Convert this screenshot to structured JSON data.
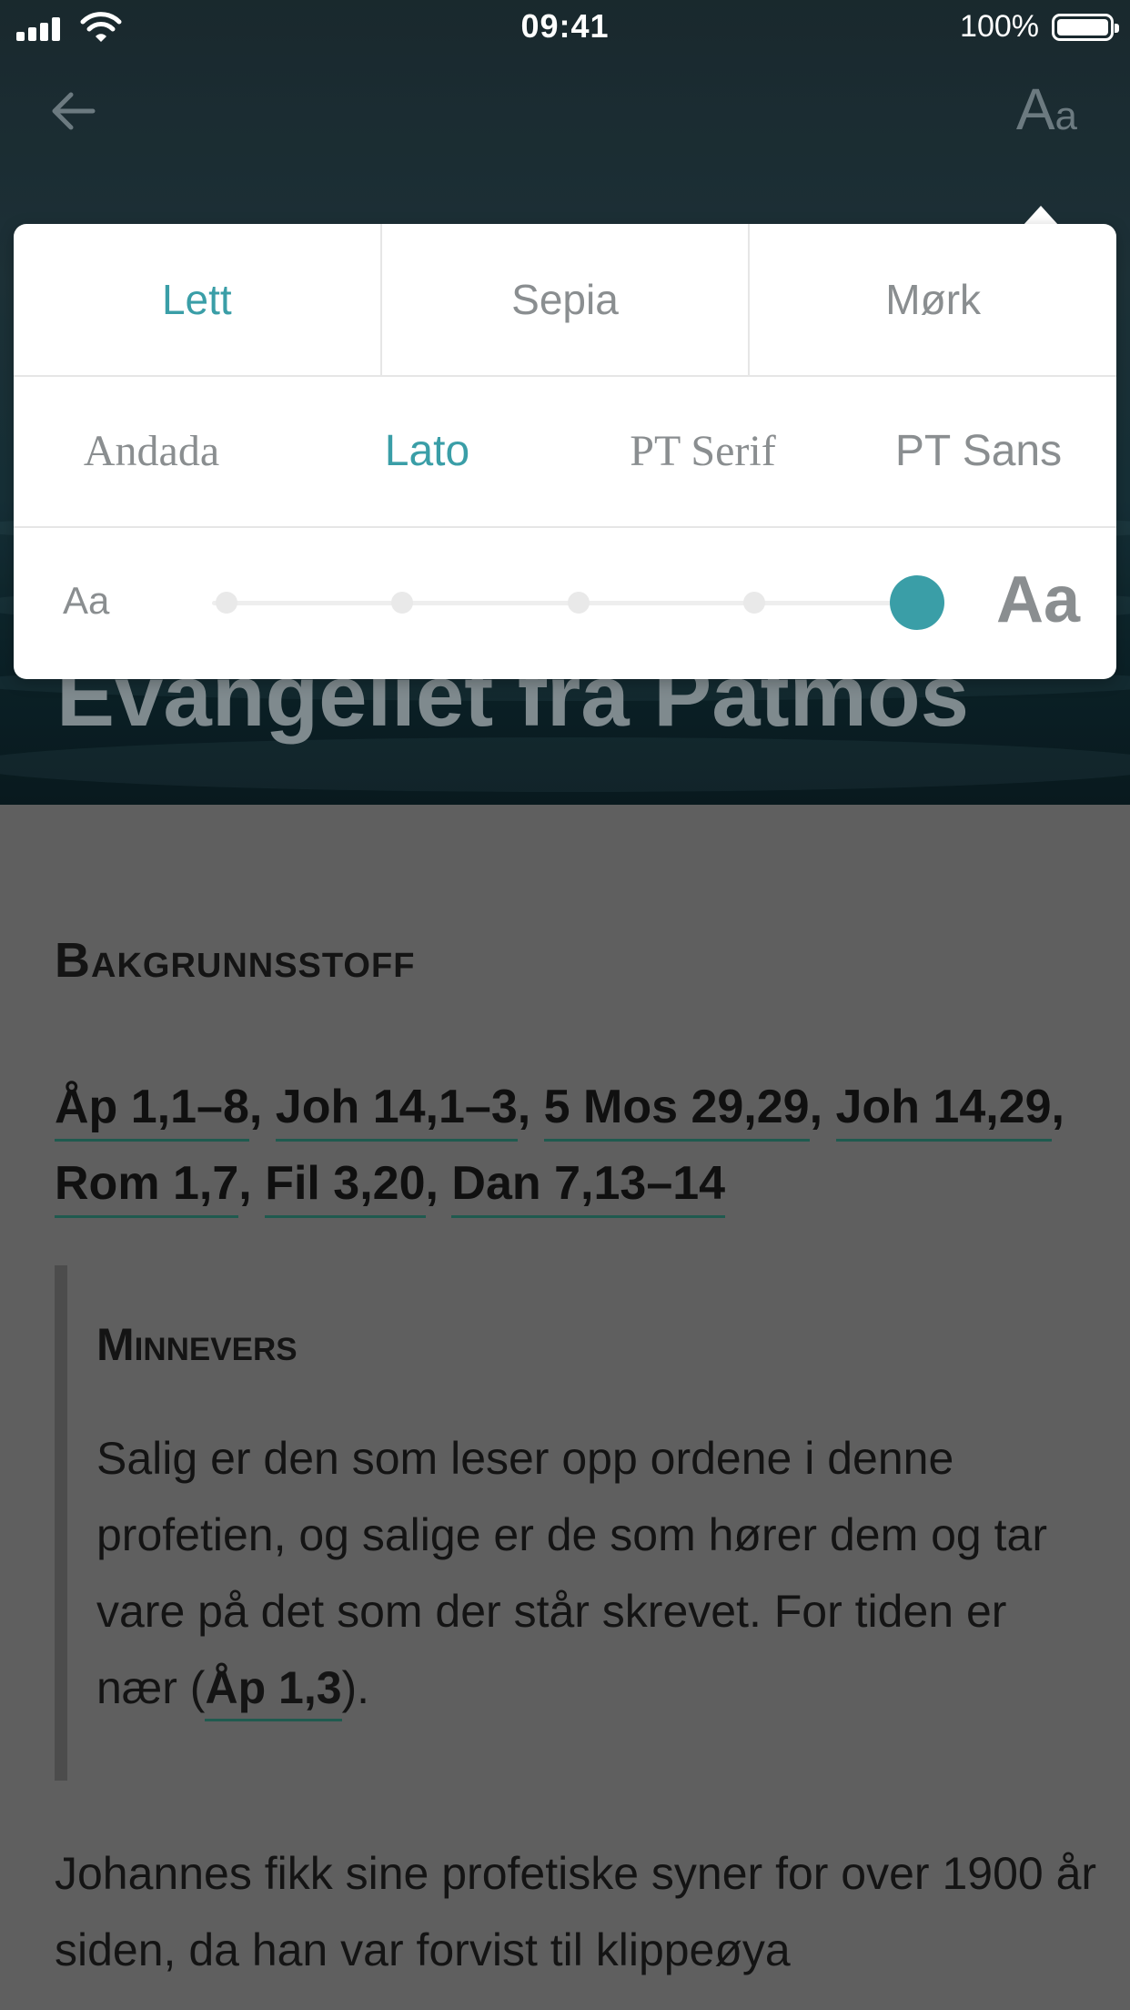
{
  "status_bar": {
    "time": "09:41",
    "battery": "100%"
  },
  "header": {
    "font_button": {
      "big": "A",
      "small": "a"
    },
    "title": "Evangeliet fra Patmos"
  },
  "settings": {
    "themes": [
      {
        "label": "Lett",
        "active": true
      },
      {
        "label": "Sepia",
        "active": false
      },
      {
        "label": "Mørk",
        "active": false
      }
    ],
    "fonts": [
      {
        "label": "Andada",
        "active": false
      },
      {
        "label": "Lato",
        "active": true
      },
      {
        "label": "PT Serif",
        "active": false
      },
      {
        "label": "PT Sans",
        "active": false
      }
    ],
    "size": {
      "small_label": "Aa",
      "large_label": "Aa",
      "steps": 5,
      "selected_step": 5
    },
    "accent_color": "#3a9ea7"
  },
  "content": {
    "section_title": "Bakgrunnsstoff",
    "refs": [
      "Åp 1,1–8",
      "Joh 14,1–3",
      "5 Mos 29,29",
      "Joh 14,29",
      "Rom 1,7",
      "Fil 3,20",
      "Dan 7,13–14"
    ],
    "memory_verse": {
      "title": "Minnevers",
      "text": "Salig er den som leser opp ordene i denne profetien, og salige er de som hører dem og tar vare på det som der står skrevet. For tiden er nær (",
      "ref": "Åp 1,3",
      "text_end": ")."
    },
    "paragraph": "Johannes fikk sine profetiske syner for over 1900 år siden, da han var forvist til klippeøya"
  }
}
